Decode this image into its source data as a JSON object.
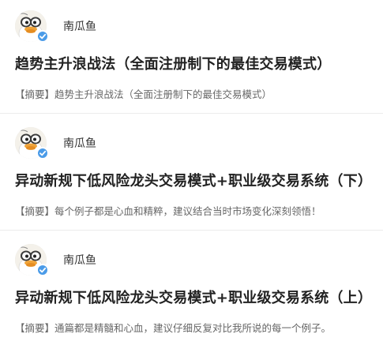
{
  "posts": [
    {
      "author": "南瓜鱼",
      "title": "趋势主升浪战法（全面注册制下的最佳交易模式）",
      "summary_label": "【摘要】",
      "summary": "趋势主升浪战法（全面注册制下的最佳交易模式）"
    },
    {
      "author": "南瓜鱼",
      "title": "异动新规下低风险龙头交易模式+职业级交易系统（下）",
      "summary_label": "【摘要】",
      "summary": "每个例子都是心血和精粹，建议结合当时市场变化深刻领悟！"
    },
    {
      "author": "南瓜鱼",
      "title": "异动新规下低风险龙头交易模式+职业级交易系统（上）",
      "summary_label": "【摘要】",
      "summary": "通篇都是精髓和心血，建议仔细反复对比我所说的每一个例子。"
    }
  ],
  "icons": {
    "avatar": "duck-cartoon-avatar-icon",
    "verified": "verified-check-badge-icon"
  },
  "colors": {
    "verified_badge": "#4a9be8",
    "title": "#222222",
    "summary": "#666666"
  }
}
